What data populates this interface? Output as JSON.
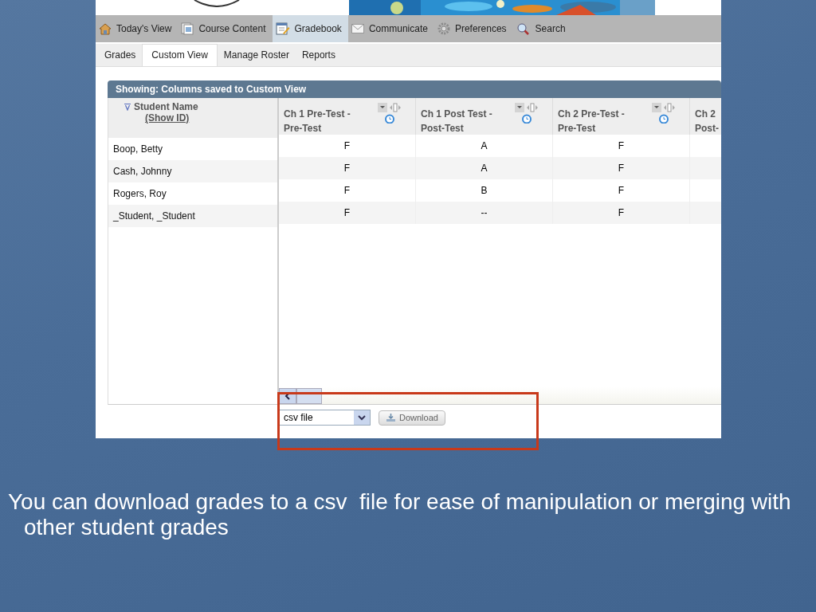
{
  "nav": [
    {
      "label": "Today's View",
      "selected": false
    },
    {
      "label": "Course Content",
      "selected": false
    },
    {
      "label": "Gradebook",
      "selected": true
    },
    {
      "label": "Communicate",
      "selected": false
    },
    {
      "label": "Preferences",
      "selected": false
    },
    {
      "label": "Search",
      "selected": false
    }
  ],
  "subtabs": [
    {
      "label": "Grades",
      "selected": false
    },
    {
      "label": "Custom View",
      "selected": true
    },
    {
      "label": "Manage Roster",
      "selected": false
    },
    {
      "label": "Reports",
      "selected": false
    }
  ],
  "grid": {
    "title": "Showing: Columns saved to Custom View",
    "name_header": "Student Name",
    "show_id": "(Show ID)",
    "columns": [
      {
        "line1": "Ch 1 Pre-Test -",
        "line2": "Pre-Test",
        "tools": true
      },
      {
        "line1": "Ch 1 Post Test -",
        "line2": "Post-Test",
        "tools": true
      },
      {
        "line1": "Ch 2 Pre-Test -",
        "line2": "Pre-Test",
        "tools": true
      },
      {
        "line1": "Ch 2",
        "line2": "Post-"
      }
    ],
    "rows": [
      {
        "name": "Boop, Betty",
        "grades": [
          "F",
          "A",
          "F"
        ]
      },
      {
        "name": "Cash, Johnny",
        "grades": [
          "F",
          "A",
          "F"
        ]
      },
      {
        "name": "Rogers, Roy",
        "grades": [
          "F",
          "B",
          "F"
        ]
      },
      {
        "name": "_Student, _Student",
        "grades": [
          "F",
          "--",
          "F"
        ]
      }
    ]
  },
  "export": {
    "format": "csv file",
    "button": "Download"
  },
  "caption": "You can download grades to a csv  file for ease of manipulation or merging with other student grades"
}
